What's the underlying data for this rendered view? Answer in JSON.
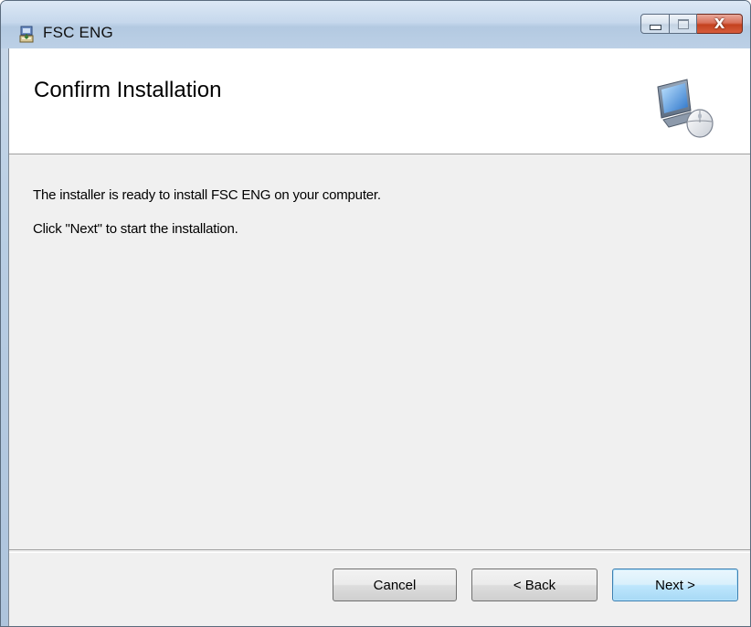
{
  "window": {
    "title": "FSC ENG",
    "app_icon": "installer-icon",
    "controls": {
      "minimize_icon": "minimize-icon",
      "maximize_icon": "maximize-icon",
      "close_glyph": "X"
    }
  },
  "banner": {
    "title": "Confirm Installation",
    "icon": "computer-setup-icon"
  },
  "body": {
    "line1": "The installer is ready to install FSC ENG on your computer.",
    "line2": "Click \"Next\" to start the installation."
  },
  "buttons": {
    "cancel": "Cancel",
    "back": "< Back",
    "next": "Next >"
  },
  "colors": {
    "close_button": "#c4421f",
    "default_button_border": "#3c7fb1",
    "dialog_background": "#f0f0f0"
  }
}
